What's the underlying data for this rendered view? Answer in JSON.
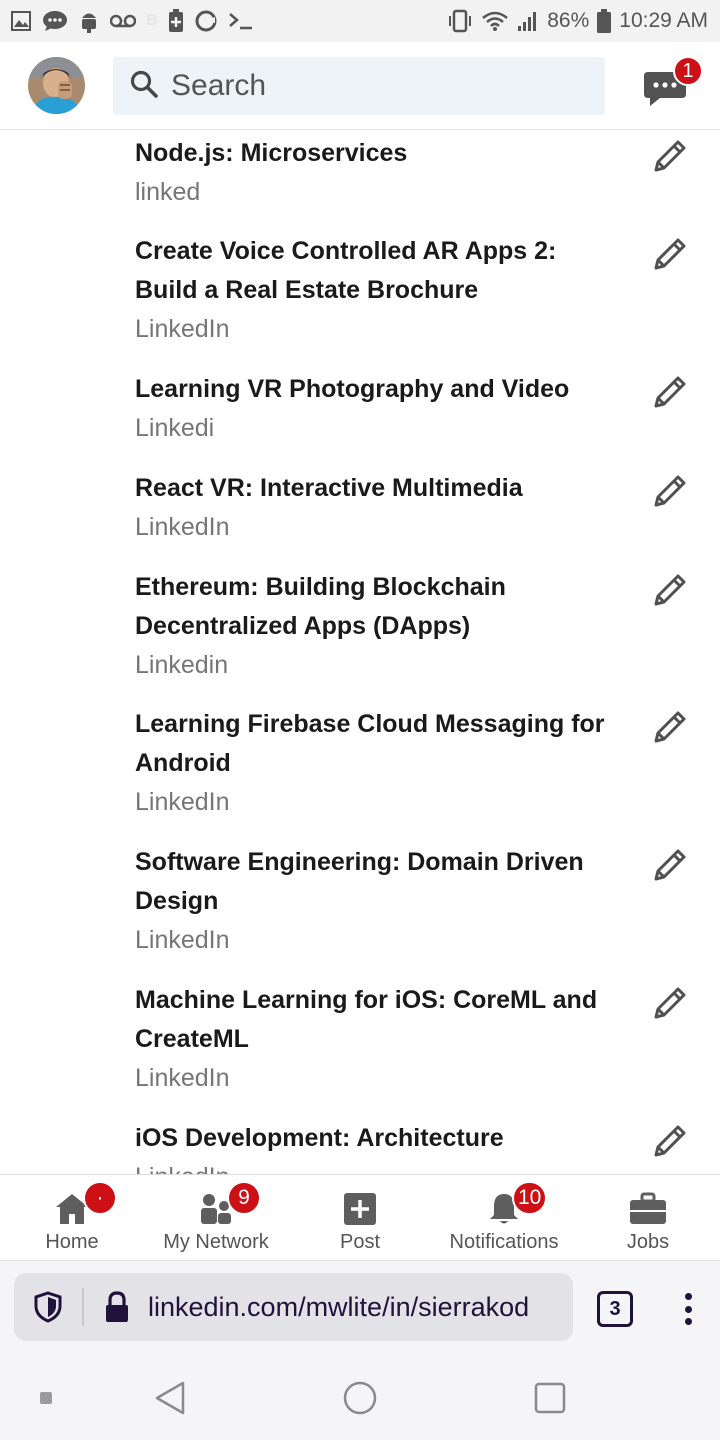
{
  "status_bar": {
    "battery": "86%",
    "time": "10:29 AM"
  },
  "header": {
    "search_placeholder": "Search",
    "messages_badge": "1"
  },
  "courses": [
    {
      "title": "Node.js: Microservices",
      "source": "linked"
    },
    {
      "title": "Create Voice Controlled AR Apps 2: Build a Real Estate Brochure",
      "source": "LinkedIn"
    },
    {
      "title": "Learning VR Photography and Video",
      "source": "Linkedi"
    },
    {
      "title": "React VR: Interactive Multimedia",
      "source": "LinkedIn"
    },
    {
      "title": "Ethereum: Building Blockchain Decentralized Apps (DApps)",
      "source": "Linkedin"
    },
    {
      "title": "Learning Firebase Cloud Messaging for Android",
      "source": "LinkedIn"
    },
    {
      "title": "Software Engineering: Domain Driven Design",
      "source": "LinkedIn"
    },
    {
      "title": "Machine Learning for iOS: CoreML and CreateML",
      "source": "LinkedIn"
    },
    {
      "title": "iOS Development: Architecture",
      "source": "LinkedIn"
    }
  ],
  "bottom_nav": {
    "home": {
      "label": "Home",
      "badge": "·"
    },
    "network": {
      "label": "My Network",
      "badge": "9"
    },
    "post": {
      "label": "Post"
    },
    "notifications": {
      "label": "Notifications",
      "badge": "10"
    },
    "jobs": {
      "label": "Jobs"
    }
  },
  "browser": {
    "url": "linkedin.com/mwlite/in/sierrakod",
    "tab_count": "3"
  },
  "colors": {
    "badge_red": "#cc1016",
    "search_bg": "#eef3f8",
    "nav_icon": "#5e5e5e"
  }
}
